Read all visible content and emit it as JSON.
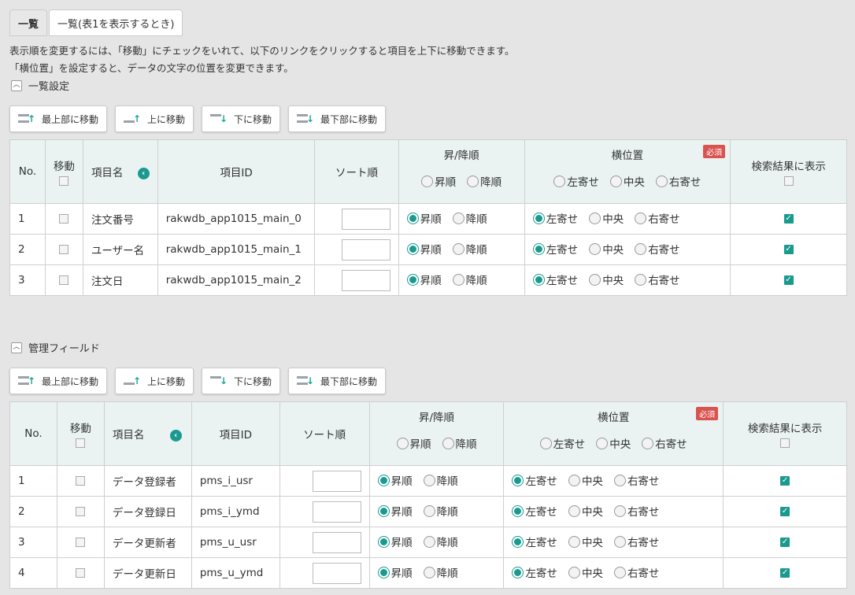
{
  "tabs": [
    "一覧",
    "一覧(表1を表示するとき)"
  ],
  "description": [
    "表示順を変更するには、「移動」にチェックをいれて、以下のリンクをクリックすると項目を上下に移動できます。",
    "「横位置」を設定すると、データの文字の位置を変更できます。"
  ],
  "move_buttons": [
    "最上部に移動",
    "上に移動",
    "下に移動",
    "最下部に移動"
  ],
  "columns": {
    "no": "No.",
    "move": "移動",
    "name": "項目名",
    "id": "項目ID",
    "sort": "ソート順",
    "order": "昇/降順",
    "asc": "昇順",
    "desc": "降順",
    "align": "横位置",
    "required": "必須",
    "left": "左寄せ",
    "center": "中央",
    "right": "右寄せ",
    "show": "検索結果に表示"
  },
  "section1": {
    "title": "一覧設定",
    "rows": [
      {
        "no": "1",
        "name": "注文番号",
        "id": "rakwdb_app1015_main_0"
      },
      {
        "no": "2",
        "name": "ユーザー名",
        "id": "rakwdb_app1015_main_1"
      },
      {
        "no": "3",
        "name": "注文日",
        "id": "rakwdb_app1015_main_2"
      }
    ]
  },
  "section2": {
    "title": "管理フィールド",
    "rows": [
      {
        "no": "1",
        "name": "データ登録者",
        "id": "pms_i_usr"
      },
      {
        "no": "2",
        "name": "データ登録日",
        "id": "pms_i_ymd"
      },
      {
        "no": "3",
        "name": "データ更新者",
        "id": "pms_u_usr"
      },
      {
        "no": "4",
        "name": "データ更新日",
        "id": "pms_u_ymd"
      }
    ]
  },
  "colors": {
    "accent": "#1a9a8f",
    "required": "#d9534f",
    "header_bg": "#eaf3f2"
  }
}
